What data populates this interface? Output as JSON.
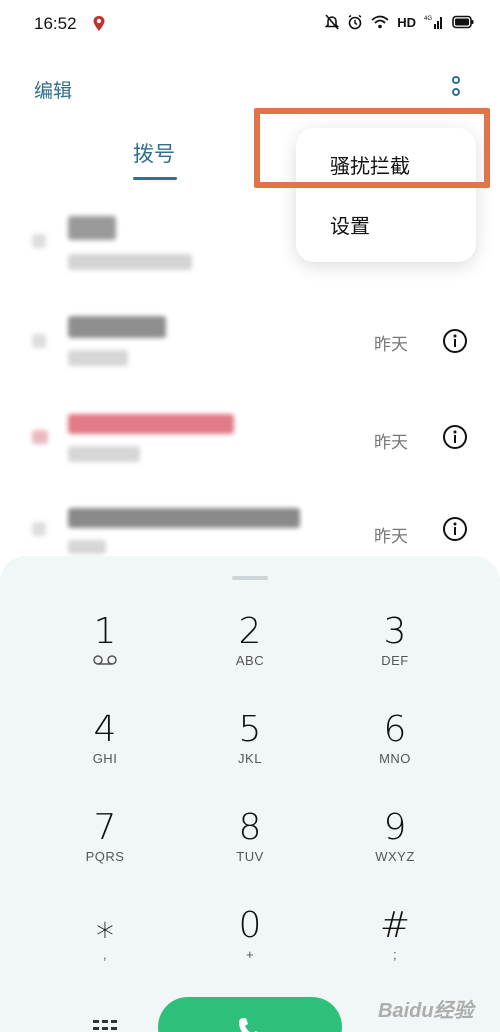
{
  "status_bar": {
    "time": "16:52",
    "network_label": "HD",
    "network_gen": "4G",
    "icons": [
      "location-pin-icon",
      "mute-bell-icon",
      "alarm-icon",
      "wifi-icon",
      "signal-icon",
      "battery-icon"
    ]
  },
  "header": {
    "edit_label": "编辑",
    "more_icon": "more-vertical-icon"
  },
  "tabs": {
    "active_label": "拨号",
    "accent_color": "#2f6f8f"
  },
  "call_log": [
    {
      "date": ""
    },
    {
      "date": "昨天"
    },
    {
      "date": "昨天"
    },
    {
      "date": "昨天"
    }
  ],
  "popup_menu": {
    "items": [
      "骚扰拦截",
      "设置"
    ],
    "highlight_color": "#e2744a"
  },
  "dialpad": {
    "keys": [
      {
        "digit": "1",
        "sub": ""
      },
      {
        "digit": "2",
        "sub": "ABC"
      },
      {
        "digit": "3",
        "sub": "DEF"
      },
      {
        "digit": "4",
        "sub": "GHI"
      },
      {
        "digit": "5",
        "sub": "JKL"
      },
      {
        "digit": "6",
        "sub": "MNO"
      },
      {
        "digit": "7",
        "sub": "PQRS"
      },
      {
        "digit": "8",
        "sub": "TUV"
      },
      {
        "digit": "9",
        "sub": "WXYZ"
      },
      {
        "digit": "⁎",
        "sub": ","
      },
      {
        "digit": "0",
        "sub": "+"
      },
      {
        "digit": "#",
        "sub": ";"
      }
    ],
    "call_color": "#2dc07a"
  },
  "watermark": "Baidu经验"
}
